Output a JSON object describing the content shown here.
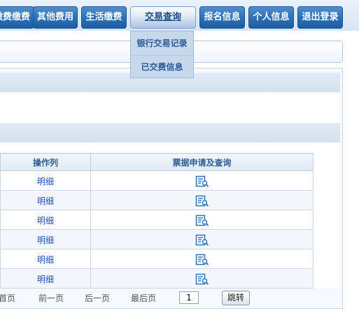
{
  "nav": {
    "tabs": [
      {
        "label": "缴费缴费"
      },
      {
        "label": "其他费用"
      },
      {
        "label": "生活缴费"
      },
      {
        "label": "交易查询"
      },
      {
        "label": "报名信息"
      },
      {
        "label": "个人信息"
      },
      {
        "label": "退出登录"
      }
    ]
  },
  "dropdown": {
    "items": [
      {
        "label": "银行交易记录"
      },
      {
        "label": "已交费信息"
      }
    ]
  },
  "table": {
    "headers": [
      "操作列",
      "票据申请及查询"
    ],
    "rows": [
      {
        "action": "明细",
        "icon": "receipt-search-icon"
      },
      {
        "action": "明细",
        "icon": "receipt-search-icon"
      },
      {
        "action": "明细",
        "icon": "receipt-search-icon"
      },
      {
        "action": "明细",
        "icon": "receipt-search-icon"
      },
      {
        "action": "明细",
        "icon": "receipt-search-icon"
      },
      {
        "action": "明细",
        "icon": "receipt-search-icon"
      }
    ]
  },
  "pagination": {
    "first": "首页",
    "prev": "前一页",
    "next": "后一页",
    "last": "最后页",
    "page_value": "1",
    "jump_label": "跳转"
  },
  "colors": {
    "nav_tab": "#2a6fb8",
    "active_tab": "#dfe9f5",
    "header_text": "#2d5d93",
    "link": "#1f4fc0",
    "icon": "#2f74b8"
  }
}
